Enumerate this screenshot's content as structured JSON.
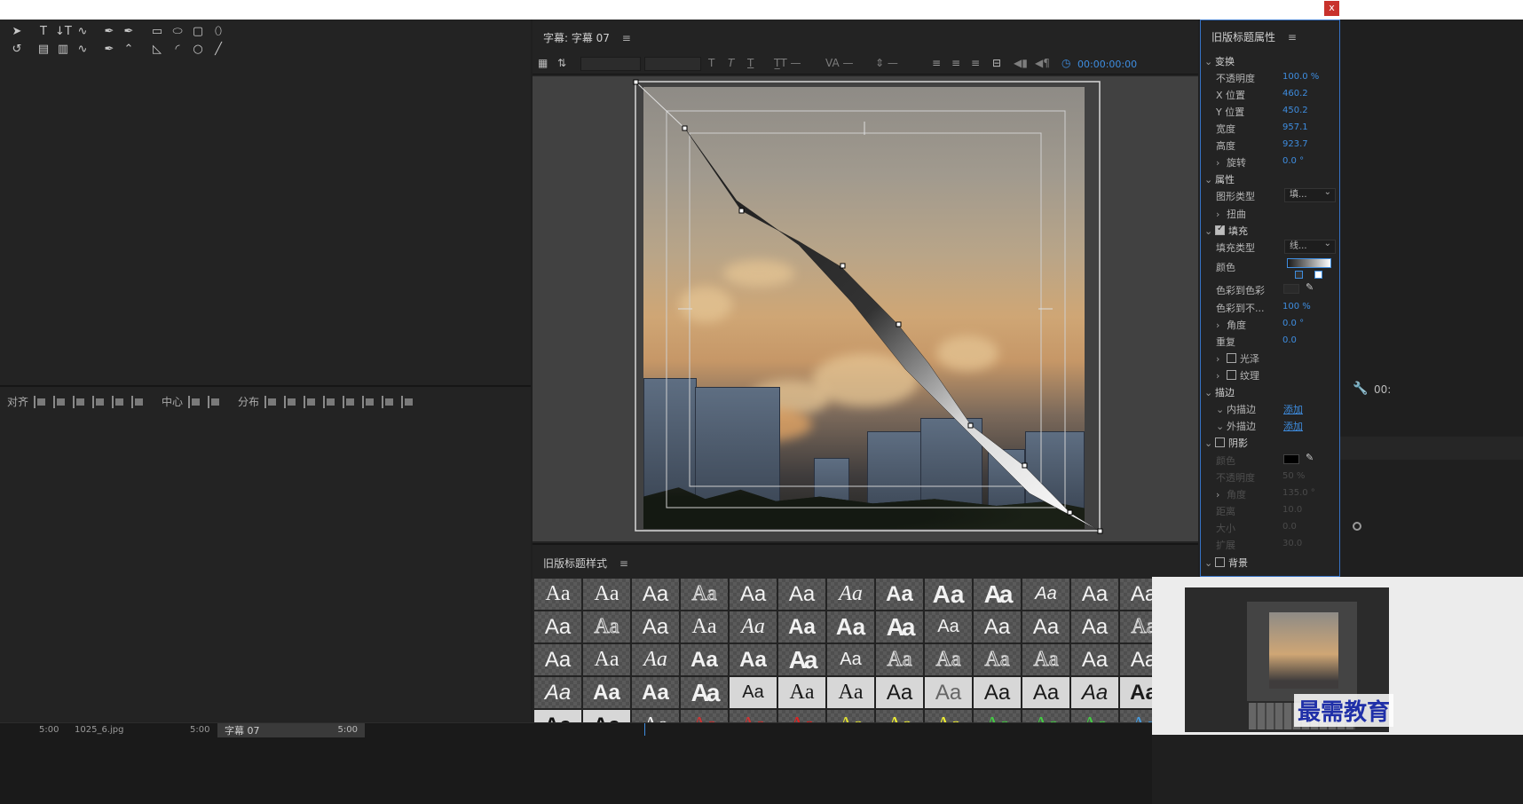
{
  "window": {
    "close_label": "x"
  },
  "align_panel": {
    "align_label": "对齐",
    "center_label": "中心",
    "distribute_label": "分布"
  },
  "titler": {
    "title": "字幕: 字幕 07",
    "menu_glyph": "≡",
    "timecode": "00:00:00:00"
  },
  "styles": {
    "title": "旧版标题样式",
    "swatch_text": "Aa"
  },
  "props": {
    "title": "旧版标题属性",
    "transform": {
      "section": "变换",
      "opacity": {
        "label": "不透明度",
        "value": "100.0 %"
      },
      "x": {
        "label": "X 位置",
        "value": "460.2"
      },
      "y": {
        "label": "Y 位置",
        "value": "450.2"
      },
      "width": {
        "label": "宽度",
        "value": "957.1"
      },
      "height": {
        "label": "高度",
        "value": "923.7"
      },
      "rotation": {
        "label": "旋转",
        "value": "0.0 °"
      }
    },
    "properties": {
      "section": "属性",
      "shape_type": {
        "label": "图形类型",
        "value": "填..."
      },
      "distort": {
        "label": "扭曲"
      }
    },
    "fill": {
      "section": "填充",
      "fill_type": {
        "label": "填充类型",
        "value": "线..."
      },
      "color": {
        "label": "颜色"
      },
      "color_stop_color": {
        "label": "色彩到色彩"
      },
      "color_stop_opacity": {
        "label": "色彩到不...",
        "value": "100 %"
      },
      "angle": {
        "label": "角度",
        "value": "0.0 °"
      },
      "repeat": {
        "label": "重复",
        "value": "0.0"
      },
      "sheen": {
        "label": "光泽"
      },
      "texture": {
        "label": "纹理"
      }
    },
    "stroke": {
      "section": "描边",
      "inner": {
        "label": "内描边",
        "action": "添加"
      },
      "outer": {
        "label": "外描边",
        "action": "添加"
      }
    },
    "shadow": {
      "section": "阴影",
      "color": {
        "label": "颜色"
      },
      "opacity": {
        "label": "不透明度",
        "value": "50 %"
      },
      "angle": {
        "label": "角度",
        "value": "135.0 °"
      },
      "distance": {
        "label": "距离",
        "value": "10.0"
      },
      "size": {
        "label": "大小",
        "value": "0.0"
      },
      "spread": {
        "label": "扩展",
        "value": "30.0"
      }
    },
    "background": {
      "section": "背景"
    }
  },
  "right_panel": {
    "timecode_fragment": "00:"
  },
  "timeline": {
    "items": [
      "5:00",
      "1025_6.jpg",
      "5:00",
      "5:00"
    ],
    "active_tab": "字幕 07"
  },
  "watermark": "最需教育",
  "colors": {
    "accent": "#3e8de0",
    "panel_bg": "#232323",
    "selection_border": "#3672c4"
  }
}
